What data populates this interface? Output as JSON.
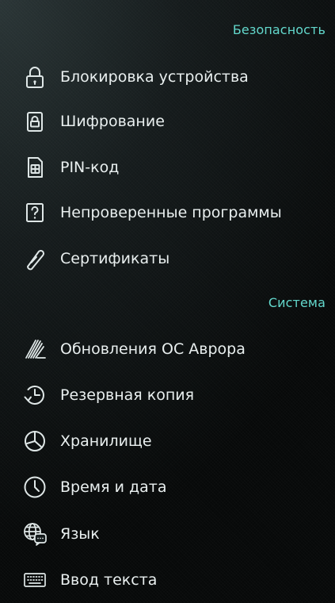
{
  "sections": {
    "security": {
      "title": "Безопасность",
      "items": [
        {
          "label": "Блокировка устройства",
          "icon": "lock-icon"
        },
        {
          "label": "Шифрование",
          "icon": "encryption-lock-icon"
        },
        {
          "label": "PIN-код",
          "icon": "sim-card-icon"
        },
        {
          "label": "Непроверенные программы",
          "icon": "question-mark-icon"
        },
        {
          "label": "Сертификаты",
          "icon": "certificate-link-icon"
        }
      ]
    },
    "system": {
      "title": "Система",
      "items": [
        {
          "label": "Обновления ОС Аврора",
          "icon": "aurora-logo-icon"
        },
        {
          "label": "Резервная копия",
          "icon": "backup-clock-icon"
        },
        {
          "label": "Хранилище",
          "icon": "storage-pie-icon"
        },
        {
          "label": "Время и дата",
          "icon": "clock-icon"
        },
        {
          "label": "Язык",
          "icon": "globe-chat-icon"
        },
        {
          "label": "Ввод текста",
          "icon": "keyboard-icon"
        }
      ]
    }
  },
  "colors": {
    "accent": "#63d8cc",
    "text": "#e9efef",
    "background_dark": "#070909"
  }
}
